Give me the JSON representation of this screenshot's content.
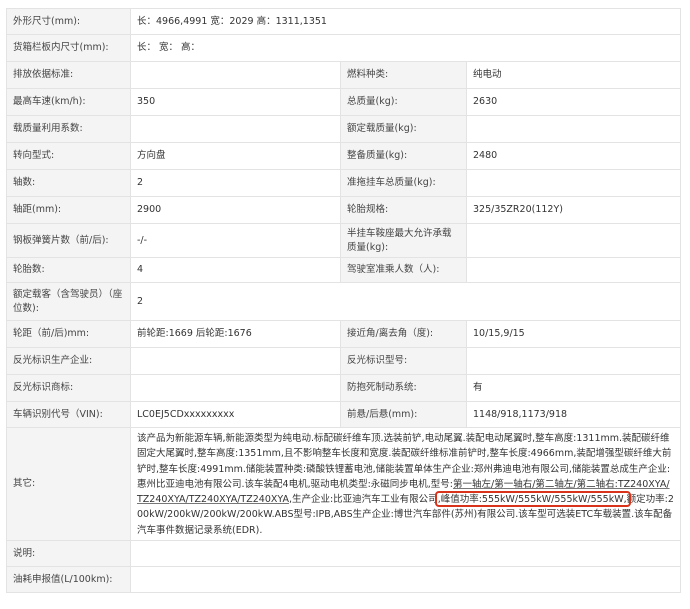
{
  "rows": [
    {
      "label": "外形尺寸(mm):",
      "value": "长：4966,4991 宽：2029 高：1311,1351"
    },
    {
      "label": "货箱栏板内尺寸(mm):",
      "value": "长：  宽：  高："
    },
    {
      "label": "排放依据标准:",
      "value": "",
      "label2": "燃料种类:",
      "value2": "纯电动"
    },
    {
      "label": "最高车速(km/h):",
      "value": "350",
      "label2": "总质量(kg):",
      "value2": "2630"
    },
    {
      "label": "载质量利用系数:",
      "value": "",
      "label2": "额定载质量(kg):",
      "value2": ""
    },
    {
      "label": "转向型式:",
      "value": "方向盘",
      "label2": "整备质量(kg):",
      "value2": "2480"
    },
    {
      "label": "轴数:",
      "value": "2",
      "label2": "准拖挂车总质量(kg):",
      "value2": ""
    },
    {
      "label": "轴距(mm):",
      "value": "2900",
      "label2": "轮胎规格:",
      "value2": "325/35ZR20(112Y)"
    },
    {
      "label": "钢板弹簧片数（前/后):",
      "value": "-/-",
      "label2": "半挂车鞍座最大允许承载质量(kg):",
      "value2": ""
    },
    {
      "label": "轮胎数:",
      "value": "4",
      "label2": "驾驶室准乘人数（人):",
      "value2": ""
    },
    {
      "label": "额定载客（含驾驶员）（座位数):",
      "value": "2"
    },
    {
      "label": "轮距（前/后)mm:",
      "value": "前轮距:1669 后轮距:1676",
      "label2": "接近角/离去角（度):",
      "value2": "10/15,9/15"
    },
    {
      "label": "反光标识生产企业:",
      "value": "",
      "label2": "反光标识型号:",
      "value2": ""
    },
    {
      "label": "反光标识商标:",
      "value": "",
      "label2": "防抱死制动系统:",
      "value2": "有"
    },
    {
      "label": "车辆识别代号（VIN):",
      "value": "LC0EJ5CDxxxxxxxxx",
      "label2": "前悬/后悬(mm):",
      "value2": "1148/918,1173/918"
    }
  ],
  "other": {
    "label": "其它:",
    "text_before": "该产品为新能源车辆,新能源类型为纯电动.标配碳纤维车顶.选装前铲,电动尾翼.装配电动尾翼时,整车高度:1311mm.装配碳纤维固定大尾翼时,整车高度:1351mm,且不影响整车长度和宽度.装配碳纤维标准前铲时,整车长度:4966mm,装配增强型碳纤维大前铲时,整车长度:4991mm.储能装置种类:磷酸铁锂蓄电池,储能装置单体生产企业:郑州弗迪电池有限公司,储能装置总成生产企业:惠州比亚迪电池有限公司.该车装配4电机,驱动电机类型:永磁同步电机,型号:",
    "text_motor_models": "第一轴左/第一轴右/第二轴左/第二轴右:TZ240XYA/TZ240XYA/TZ240XYA/TZ240XYA",
    "text_mid": ",生产企业:比亚迪汽车工业有限公司",
    "text_highlight": ",峰值功率:555kW/555kW/555kW/555kW,",
    "text_after": "额定功率:200kW/200kW/200kW/200kW.ABS型号:IPB,ABS生产企业:博世汽车部件(苏州)有限公司.该车型可选装ETC车载装置.该车配备汽车事件数据记录系统(EDR)."
  },
  "tail_rows": [
    {
      "label": "说明:",
      "value": ""
    },
    {
      "label": "油耗申报值(L/100km):",
      "value": ""
    }
  ],
  "highlight_color": "#d9331c"
}
